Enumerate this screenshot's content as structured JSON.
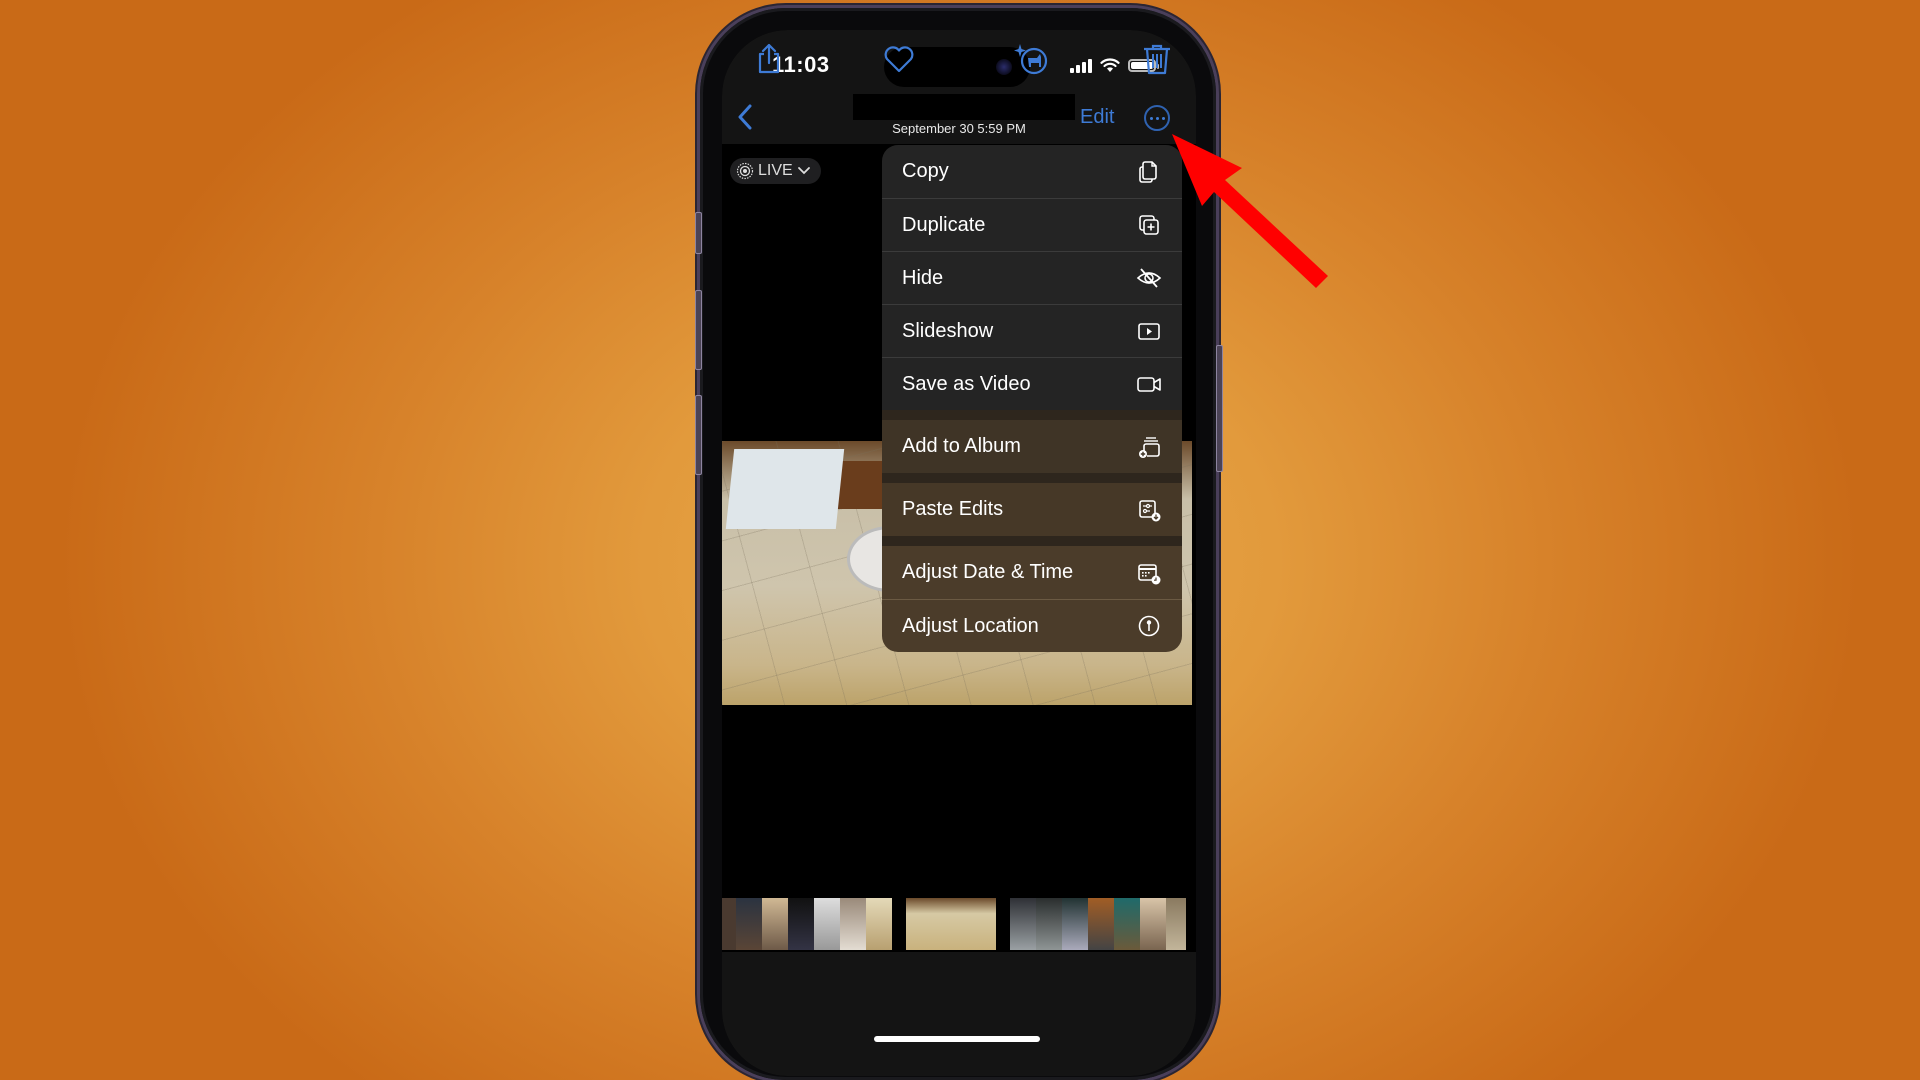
{
  "status_bar": {
    "time": "11:03",
    "icons": [
      "cellular-signal-icon",
      "wifi-icon",
      "battery-icon"
    ]
  },
  "nav": {
    "back_icon": "chevron-left-icon",
    "date": "September 30  5:59 PM",
    "edit_label": "Edit",
    "more_icon": "ellipsis-circle-icon"
  },
  "live_badge": {
    "label": "LIVE",
    "icon": "live-photo-icon",
    "chevron": "chevron-down-icon"
  },
  "menu": {
    "groups": [
      [
        {
          "label": "Copy",
          "icon": "copy-icon"
        },
        {
          "label": "Duplicate",
          "icon": "duplicate-icon"
        },
        {
          "label": "Hide",
          "icon": "eye-slash-icon"
        },
        {
          "label": "Slideshow",
          "icon": "play-rectangle-icon"
        },
        {
          "label": "Save as Video",
          "icon": "video-camera-icon"
        }
      ],
      [
        {
          "label": "Add to Album",
          "icon": "add-to-album-icon"
        }
      ],
      [
        {
          "label": "Paste Edits",
          "icon": "paste-edits-icon"
        }
      ],
      [
        {
          "label": "Adjust Date & Time",
          "icon": "calendar-clock-icon"
        },
        {
          "label": "Adjust Location",
          "icon": "location-pin-circle-icon"
        }
      ]
    ]
  },
  "toolbar": {
    "share": "share-icon",
    "favorite": "heart-icon",
    "visual_lookup": "visual-lookup-pet-icon",
    "delete": "trash-icon"
  },
  "colors": {
    "accent": "#3e7bd6",
    "annotation_arrow": "#ff0000",
    "background": "#e29a3c"
  }
}
